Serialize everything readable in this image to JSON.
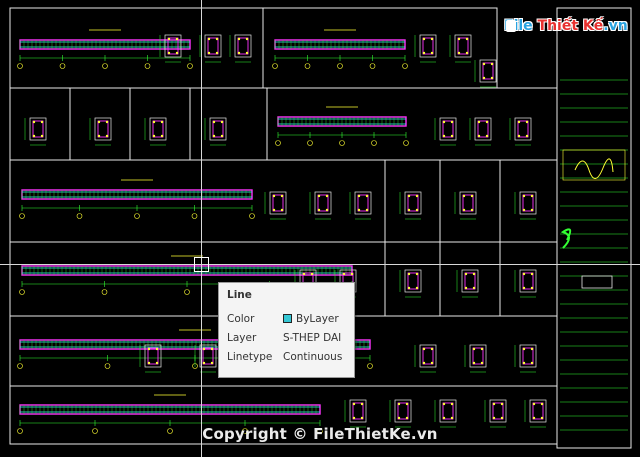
{
  "brand": {
    "name_main": "File",
    "name_rest": "Thiết Kế",
    "name_tld": ".vn"
  },
  "tooltip": {
    "title": "Line",
    "rows": [
      {
        "label": "Color",
        "value": "ByLayer",
        "swatch": "#35c7d4"
      },
      {
        "label": "Layer",
        "value": "S-THEP DAI"
      },
      {
        "label": "Linetype",
        "value": "Continuous"
      }
    ]
  },
  "watermark": "Copyright © FileThietKe.vn",
  "colors": {
    "background": "#000000",
    "border_white": "#e8e8e8",
    "rebar_magenta": "#ff33ff",
    "dim_green": "#33ff33",
    "text_yellow": "#ffff33",
    "detail_cyan": "#33ffff",
    "accent_red": "#ff3333"
  },
  "icons": {
    "brand_logo": "file-logo-icon",
    "crosshair": "cad-crosshair-cursor",
    "pickbox": "cad-pickbox-icon",
    "color_swatch": "bylayer-color-swatch-icon"
  }
}
